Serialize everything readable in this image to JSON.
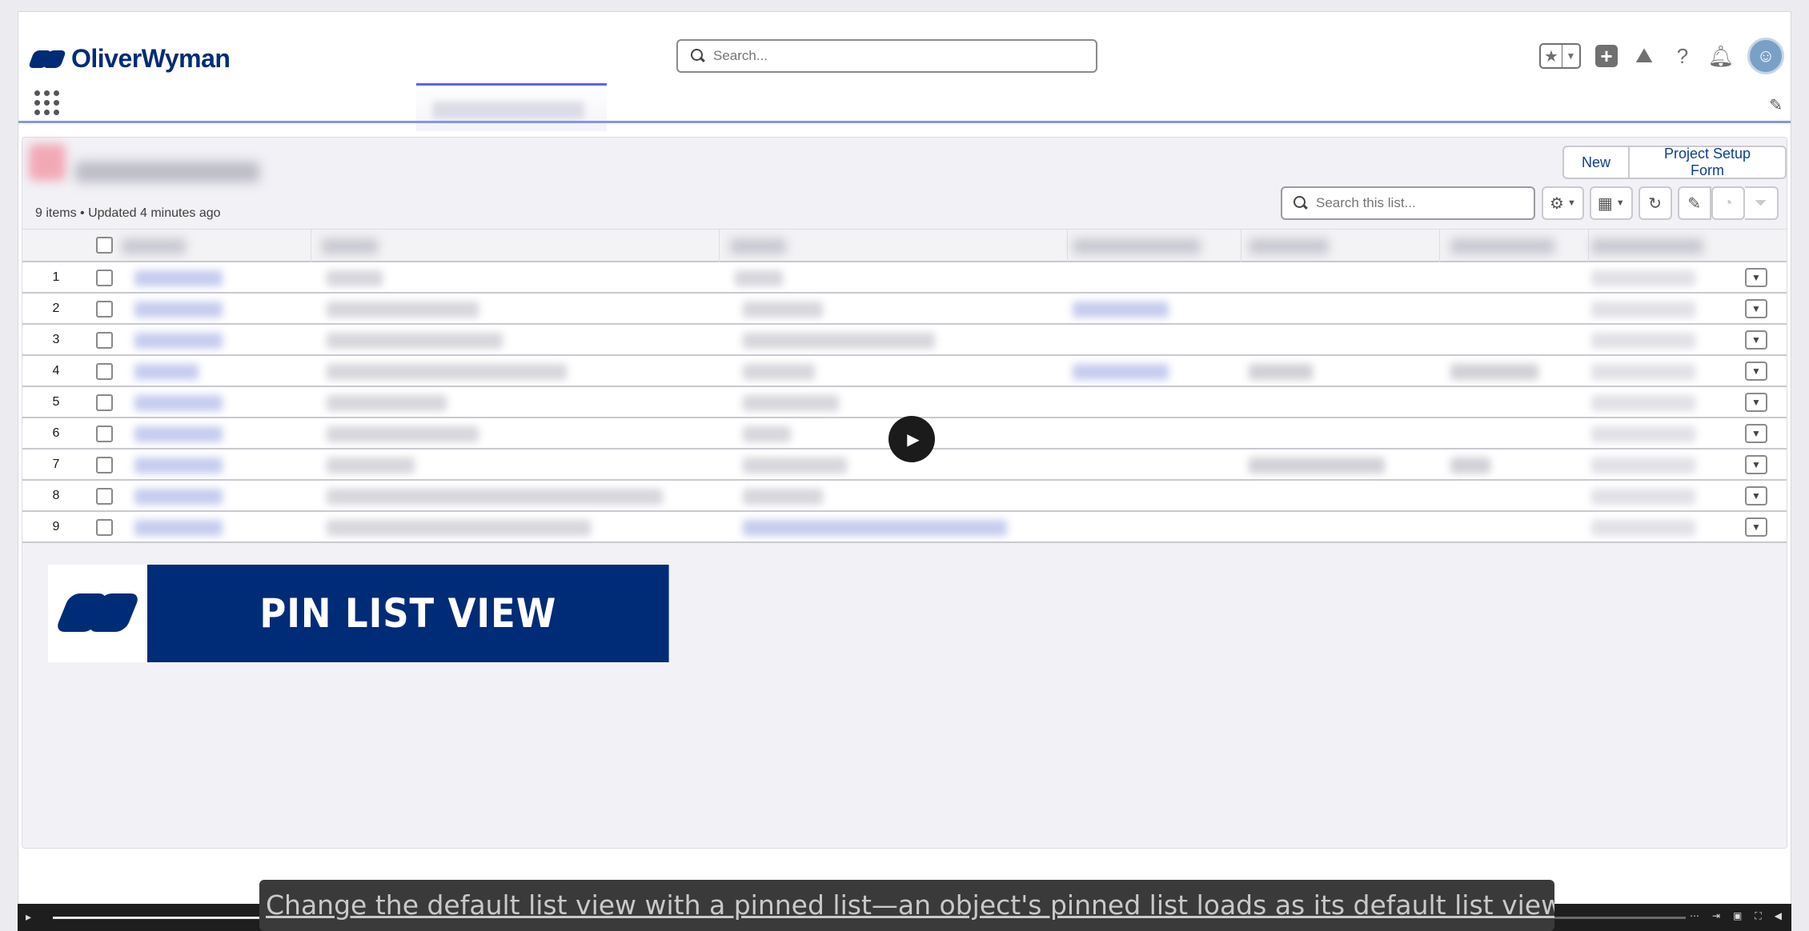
{
  "header": {
    "logo_text": "OliverWyman",
    "search_placeholder": "Search...",
    "icons": [
      "star-icon",
      "chevron-down-icon",
      "plus-icon",
      "trailhead-icon",
      "help-icon",
      "bell-icon",
      "avatar"
    ]
  },
  "list": {
    "meta": "9 items • Updated 4 minutes ago",
    "buttons": {
      "new": "New",
      "project_setup": "Project Setup Form"
    },
    "search_placeholder": "Search this list...",
    "rows": [
      "1",
      "2",
      "3",
      "4",
      "5",
      "6",
      "7",
      "8",
      "9"
    ]
  },
  "banner": {
    "text": "PIN LIST VIEW"
  },
  "video": {
    "caption": "Change the default list view with a pinned list—an object's pinned list loads as its default list view.",
    "progress_fraction": 0.42
  },
  "colors": {
    "brand": "#002c77",
    "accent": "#5867e8"
  }
}
